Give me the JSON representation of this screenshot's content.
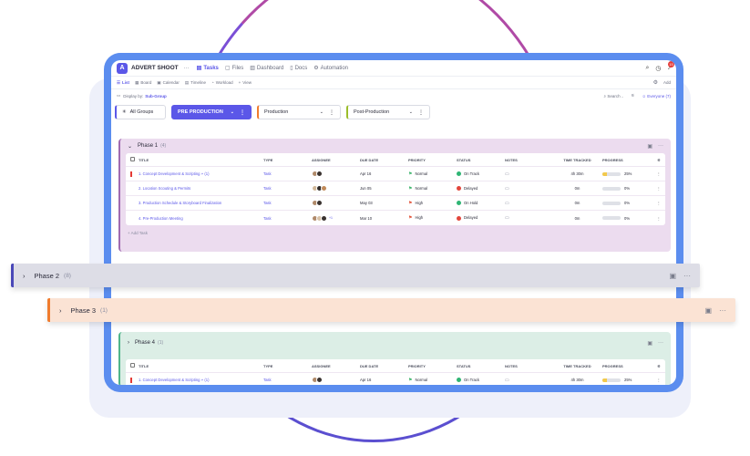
{
  "app": {
    "logo_letter": "A",
    "title": "ADVERT SHOOT",
    "more": "···",
    "tabs": [
      {
        "label": "Tasks",
        "icon": "tasks-icon"
      },
      {
        "label": "Files",
        "icon": "files-icon"
      },
      {
        "label": "Dashboard",
        "icon": "dashboard-icon"
      },
      {
        "label": "Docs",
        "icon": "docs-icon"
      },
      {
        "label": "Automation",
        "icon": "automation-icon"
      }
    ],
    "notification_count": "15"
  },
  "views": {
    "items": [
      "List",
      "Board",
      "Calendar",
      "Timeline",
      "Workload",
      "View"
    ],
    "add_label": "Add"
  },
  "display": {
    "label": "Display by:",
    "value": "Sub-Group",
    "search_placeholder": "Search ..",
    "everyone": "Everyone (7)"
  },
  "groups": {
    "all": "All Groups",
    "chips": [
      "PRE PRODUCTION",
      "Production",
      "Post-Production"
    ]
  },
  "phase1": {
    "name": "Phase 1",
    "count": "(4)",
    "columns": [
      "TITLE",
      "TYPE",
      "ASSIGNEE",
      "DUE DATE",
      "PRIORITY",
      "STATUS",
      "NOTES",
      "TIME TRACKED",
      "PROGRESS"
    ],
    "rows": [
      {
        "title": "1. Concept Development & Scripting",
        "sub": "(1)",
        "type": "Task",
        "extra": "",
        "due": "Apr 16",
        "priority": "Normal",
        "status": "On Track",
        "status_color": "#2fb574",
        "time": "4h 30m",
        "progress": "25%",
        "progress_value": 25
      },
      {
        "title": "2. Location Scouting & Permits",
        "sub": "",
        "type": "Task",
        "extra": "",
        "due": "Jun 05",
        "priority": "Normal",
        "status": "Delayed",
        "status_color": "#e2453b",
        "time": "0m",
        "progress": "0%",
        "progress_value": 0
      },
      {
        "title": "3. Production Schedule & Storyboard Finalization",
        "sub": "",
        "type": "Task",
        "extra": "",
        "due": "May 03",
        "priority": "High",
        "status": "On Hold",
        "status_color": "#2fb574",
        "time": "0m",
        "progress": "0%",
        "progress_value": 0
      },
      {
        "title": "4. Pre-Production Meeting",
        "sub": "",
        "type": "Task",
        "extra": "+1",
        "due": "Mar 10",
        "priority": "High",
        "status": "Delayed",
        "status_color": "#e2453b",
        "time": "0m",
        "progress": "0%",
        "progress_value": 0
      }
    ],
    "add_task": "+ Add Task"
  },
  "phase2": {
    "name": "Phase 2",
    "count": "(8)"
  },
  "phase3": {
    "name": "Phase 3",
    "count": "(1)"
  },
  "phase4": {
    "name": "Phase 4",
    "count": "(1)",
    "row": {
      "title": "1. Concept Development & Scripting",
      "sub": "(1)",
      "type": "Task",
      "due": "Apr 16",
      "priority": "Normal",
      "status": "On Track",
      "time": "4h 30m",
      "progress": "25%"
    }
  },
  "colors": {
    "accent": "#5b57e8",
    "phase1": "#a06ab0",
    "phase2": "#4a48b8",
    "phase3": "#f07c2e",
    "phase4": "#4fb58a"
  }
}
